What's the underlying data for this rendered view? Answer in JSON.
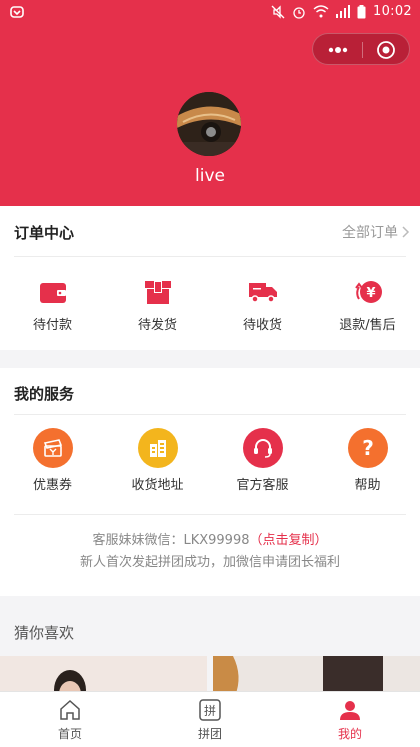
{
  "status_bar": {
    "time": "10:02"
  },
  "profile": {
    "username": "live"
  },
  "order_center": {
    "title": "订单中心",
    "all_orders": "全部订单",
    "items": [
      {
        "label": "待付款",
        "icon": "wallet-icon"
      },
      {
        "label": "待发货",
        "icon": "package-icon"
      },
      {
        "label": "待收货",
        "icon": "truck-icon"
      },
      {
        "label": "退款/售后",
        "icon": "refund-icon"
      }
    ]
  },
  "services": {
    "title": "我的服务",
    "items": [
      {
        "label": "优惠券",
        "icon": "coupon-icon",
        "color": "#f4702e"
      },
      {
        "label": "收货地址",
        "icon": "building-icon",
        "color": "#f3b51d"
      },
      {
        "label": "官方客服",
        "icon": "headset-icon",
        "color": "#e5304b"
      },
      {
        "label": "帮助",
        "icon": "help-icon",
        "color": "#f4702e"
      }
    ],
    "wechat_text": "客服妹妹微信：LKX99998",
    "copy_link": "（点击复制）",
    "promo_text": "新人首次发起拼团成功，加微信申请团长福利"
  },
  "guess": {
    "title": "猜你喜欢"
  },
  "tabbar": {
    "items": [
      {
        "label": "首页",
        "icon": "home-icon"
      },
      {
        "label": "拼团",
        "icon": "pintuan-icon"
      },
      {
        "label": "我的",
        "icon": "user-icon"
      }
    ]
  },
  "colors": {
    "brand": "#e5304b",
    "orange": "#f4702e",
    "yellow": "#f3b51d"
  }
}
